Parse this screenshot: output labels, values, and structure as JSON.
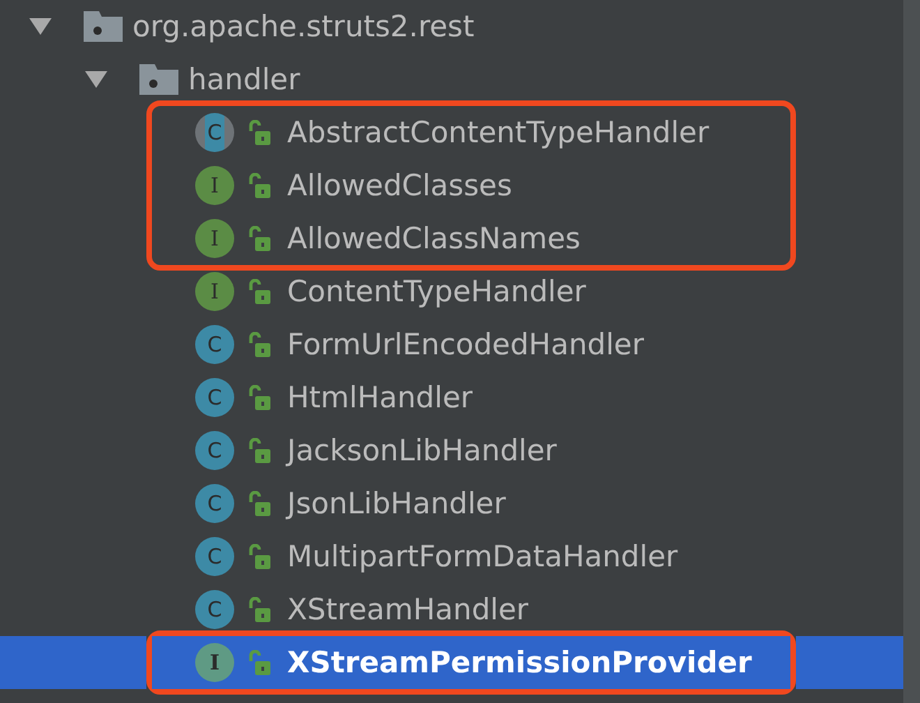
{
  "tree": [
    {
      "kind": "package",
      "label": "org.apache.struts2.rest",
      "expanded": true,
      "children": [
        {
          "kind": "package",
          "label": "handler",
          "expanded": true,
          "children": [
            {
              "kind": "abstract_class",
              "badge": "C",
              "label": "AbstractContentTypeHandler",
              "selected": false,
              "boxed": true
            },
            {
              "kind": "interface",
              "badge": "I",
              "label": "AllowedClasses",
              "selected": false,
              "boxed": true
            },
            {
              "kind": "interface",
              "badge": "I",
              "label": "AllowedClassNames",
              "selected": false,
              "boxed": true
            },
            {
              "kind": "interface",
              "badge": "I",
              "label": "ContentTypeHandler",
              "selected": false,
              "boxed": false
            },
            {
              "kind": "class",
              "badge": "C",
              "label": "FormUrlEncodedHandler",
              "selected": false,
              "boxed": false
            },
            {
              "kind": "class",
              "badge": "C",
              "label": "HtmlHandler",
              "selected": false,
              "boxed": false
            },
            {
              "kind": "class",
              "badge": "C",
              "label": "JacksonLibHandler",
              "selected": false,
              "boxed": false
            },
            {
              "kind": "class",
              "badge": "C",
              "label": "JsonLibHandler",
              "selected": false,
              "boxed": false
            },
            {
              "kind": "class",
              "badge": "C",
              "label": "MultipartFormDataHandler",
              "selected": false,
              "boxed": false
            },
            {
              "kind": "class",
              "badge": "C",
              "label": "XStreamHandler",
              "selected": false,
              "boxed": false
            },
            {
              "kind": "interface",
              "badge": "I",
              "label": "XStreamPermissionProvider",
              "selected": true,
              "boxed": true
            }
          ]
        }
      ]
    }
  ]
}
